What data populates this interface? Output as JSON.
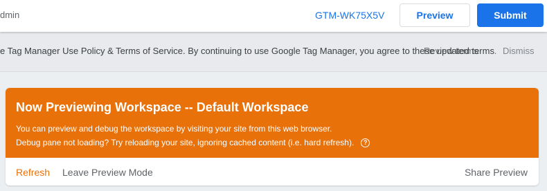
{
  "header": {
    "admin_text": "dmin",
    "container_id": "GTM-WK75X5V",
    "preview_label": "Preview",
    "submit_label": "Submit"
  },
  "tos_bar": {
    "text": "e Tag Manager Use Policy & Terms of Service. By continuing to use Google Tag Manager, you agree to these updated terms.",
    "review_label": "Review terms",
    "dismiss_label": "Dismiss"
  },
  "preview_card": {
    "title": "Now Previewing Workspace -- Default Workspace",
    "line1": "You can preview and debug the workspace by visiting your site from this web browser.",
    "line2": "Debug pane not loading? Try reloading your site, ignoring cached content (i.e. hard refresh).",
    "help_glyph": "?",
    "refresh_label": "Refresh",
    "leave_label": "Leave Preview Mode",
    "share_label": "Share Preview"
  },
  "colors": {
    "accent_blue": "#1a73e8",
    "preview_orange": "#e8710a"
  }
}
